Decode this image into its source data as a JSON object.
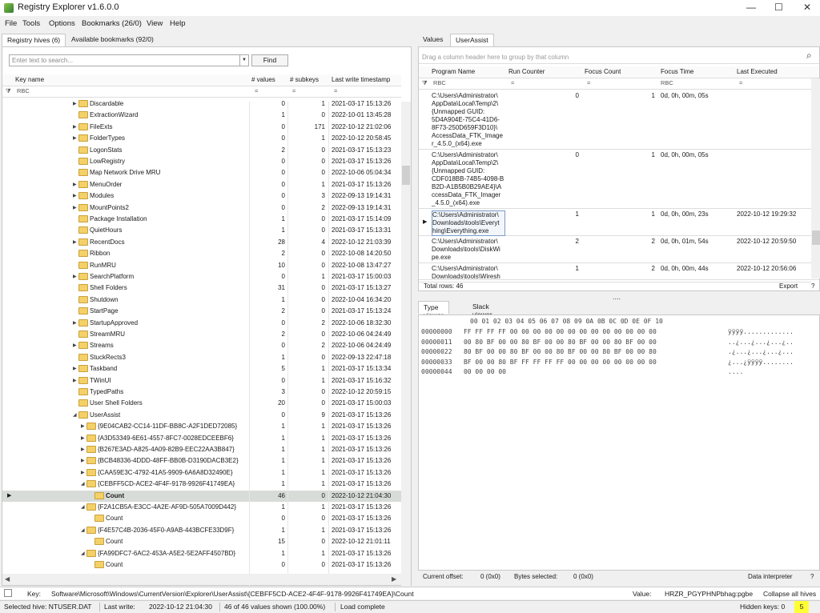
{
  "window": {
    "title": "Registry Explorer v1.6.0.0",
    "minimize": "—",
    "maximize": "☐",
    "close": "✕"
  },
  "menu": [
    "File",
    "Tools",
    "Options",
    "Bookmarks (26/0)",
    "View",
    "Help"
  ],
  "left_tabs": [
    "Registry hives (6)",
    "Available bookmarks (92/0)"
  ],
  "search": {
    "placeholder": "Enter text to search...",
    "find": "Find"
  },
  "tree_columns": [
    "Key name",
    "# values",
    "# subkeys",
    "Last write timestamp"
  ],
  "filter_glyph": "RBC",
  "filter_eq": "=",
  "tree_rows": [
    {
      "name": "Discardable",
      "values": "0",
      "subkeys": "1",
      "ts": "2021-03-17 15:13:26",
      "depth": 0,
      "exp": "▶"
    },
    {
      "name": "ExtractionWizard",
      "values": "1",
      "subkeys": "0",
      "ts": "2022-10-01 13:45:28",
      "depth": 0,
      "exp": ""
    },
    {
      "name": "FileExts",
      "values": "0",
      "subkeys": "171",
      "ts": "2022-10-12 21:02:06",
      "depth": 0,
      "exp": "▶"
    },
    {
      "name": "FolderTypes",
      "values": "0",
      "subkeys": "1",
      "ts": "2022-10-12 20:58:45",
      "depth": 0,
      "exp": "▶"
    },
    {
      "name": "LogonStats",
      "values": "2",
      "subkeys": "0",
      "ts": "2021-03-17 15:13:23",
      "depth": 0,
      "exp": ""
    },
    {
      "name": "LowRegistry",
      "values": "0",
      "subkeys": "0",
      "ts": "2021-03-17 15:13:26",
      "depth": 0,
      "exp": ""
    },
    {
      "name": "Map Network Drive MRU",
      "values": "0",
      "subkeys": "0",
      "ts": "2022-10-06 05:04:34",
      "depth": 0,
      "exp": ""
    },
    {
      "name": "MenuOrder",
      "values": "0",
      "subkeys": "1",
      "ts": "2021-03-17 15:13:26",
      "depth": 0,
      "exp": "▶"
    },
    {
      "name": "Modules",
      "values": "0",
      "subkeys": "3",
      "ts": "2022-09-13 19:14:31",
      "depth": 0,
      "exp": "▶"
    },
    {
      "name": "MountPoints2",
      "values": "0",
      "subkeys": "2",
      "ts": "2022-09-13 19:14:31",
      "depth": 0,
      "exp": "▶"
    },
    {
      "name": "Package Installation",
      "values": "1",
      "subkeys": "0",
      "ts": "2021-03-17 15:14:09",
      "depth": 0,
      "exp": ""
    },
    {
      "name": "QuietHours",
      "values": "1",
      "subkeys": "0",
      "ts": "2021-03-17 15:13:31",
      "depth": 0,
      "exp": ""
    },
    {
      "name": "RecentDocs",
      "values": "28",
      "subkeys": "4",
      "ts": "2022-10-12 21:03:39",
      "depth": 0,
      "exp": "▶"
    },
    {
      "name": "Ribbon",
      "values": "2",
      "subkeys": "0",
      "ts": "2022-10-08 14:20:50",
      "depth": 0,
      "exp": ""
    },
    {
      "name": "RunMRU",
      "values": "10",
      "subkeys": "0",
      "ts": "2022-10-08 13:47:27",
      "depth": 0,
      "exp": ""
    },
    {
      "name": "SearchPlatform",
      "values": "0",
      "subkeys": "1",
      "ts": "2021-03-17 15:00:03",
      "depth": 0,
      "exp": "▶"
    },
    {
      "name": "Shell Folders",
      "values": "31",
      "subkeys": "0",
      "ts": "2021-03-17 15:13:27",
      "depth": 0,
      "exp": ""
    },
    {
      "name": "Shutdown",
      "values": "1",
      "subkeys": "0",
      "ts": "2022-10-04 16:34:20",
      "depth": 0,
      "exp": ""
    },
    {
      "name": "StartPage",
      "values": "2",
      "subkeys": "0",
      "ts": "2021-03-17 15:13:24",
      "depth": 0,
      "exp": ""
    },
    {
      "name": "StartupApproved",
      "values": "0",
      "subkeys": "2",
      "ts": "2022-10-06 18:32:30",
      "depth": 0,
      "exp": "▶"
    },
    {
      "name": "StreamMRU",
      "values": "2",
      "subkeys": "0",
      "ts": "2022-10-06 04:24:49",
      "depth": 0,
      "exp": ""
    },
    {
      "name": "Streams",
      "values": "0",
      "subkeys": "2",
      "ts": "2022-10-06 04:24:49",
      "depth": 0,
      "exp": "▶"
    },
    {
      "name": "StuckRects3",
      "values": "1",
      "subkeys": "0",
      "ts": "2022-09-13 22:47:18",
      "depth": 0,
      "exp": ""
    },
    {
      "name": "Taskband",
      "values": "5",
      "subkeys": "1",
      "ts": "2021-03-17 15:13:34",
      "depth": 0,
      "exp": "▶"
    },
    {
      "name": "TWinUI",
      "values": "0",
      "subkeys": "1",
      "ts": "2021-03-17 15:16:32",
      "depth": 0,
      "exp": "▶"
    },
    {
      "name": "TypedPaths",
      "values": "3",
      "subkeys": "0",
      "ts": "2022-10-12 20:59:15",
      "depth": 0,
      "exp": ""
    },
    {
      "name": "User Shell Folders",
      "values": "20",
      "subkeys": "0",
      "ts": "2021-03-17 15:00:03",
      "depth": 0,
      "exp": ""
    },
    {
      "name": "UserAssist",
      "values": "0",
      "subkeys": "9",
      "ts": "2021-03-17 15:13:26",
      "depth": 0,
      "exp": "◢"
    },
    {
      "name": "{9E04CAB2-CC14-11DF-BB8C-A2F1DED72085}",
      "values": "1",
      "subkeys": "1",
      "ts": "2021-03-17 15:13:26",
      "depth": 1,
      "exp": "▶"
    },
    {
      "name": "{A3D53349-6E61-4557-8FC7-0028EDCEEBF6}",
      "values": "1",
      "subkeys": "1",
      "ts": "2021-03-17 15:13:26",
      "depth": 1,
      "exp": "▶"
    },
    {
      "name": "{B267E3AD-A825-4A09-82B9-EEC22AA3B847}",
      "values": "1",
      "subkeys": "1",
      "ts": "2021-03-17 15:13:26",
      "depth": 1,
      "exp": "▶"
    },
    {
      "name": "{BCB48336-4DDD-48FF-BB0B-D3190DACB3E2}",
      "values": "1",
      "subkeys": "1",
      "ts": "2021-03-17 15:13:26",
      "depth": 1,
      "exp": "▶"
    },
    {
      "name": "{CAA59E3C-4792-41A5-9909-6A6A8D32490E}",
      "values": "1",
      "subkeys": "1",
      "ts": "2021-03-17 15:13:26",
      "depth": 1,
      "exp": "▶"
    },
    {
      "name": "{CEBFF5CD-ACE2-4F4F-9178-9926F41749EA}",
      "values": "1",
      "subkeys": "1",
      "ts": "2021-03-17 15:13:26",
      "depth": 1,
      "exp": "◢"
    },
    {
      "name": "Count",
      "values": "46",
      "subkeys": "0",
      "ts": "2022-10-12 21:04:30",
      "depth": 2,
      "exp": "",
      "selected": true
    },
    {
      "name": "{F2A1CB5A-E3CC-4A2E-AF9D-505A7009D442}",
      "values": "1",
      "subkeys": "1",
      "ts": "2021-03-17 15:13:26",
      "depth": 1,
      "exp": "◢"
    },
    {
      "name": "Count",
      "values": "0",
      "subkeys": "0",
      "ts": "2021-03-17 15:13:26",
      "depth": 2,
      "exp": ""
    },
    {
      "name": "{F4E57C4B-2036-45F0-A9AB-443BCFE33D9F}",
      "values": "1",
      "subkeys": "1",
      "ts": "2021-03-17 15:13:26",
      "depth": 1,
      "exp": "◢"
    },
    {
      "name": "Count",
      "values": "15",
      "subkeys": "0",
      "ts": "2022-10-12 21:01:11",
      "depth": 2,
      "exp": ""
    },
    {
      "name": "{FA99DFC7-6AC2-453A-A5E2-5E2AFF4507BD}",
      "values": "1",
      "subkeys": "1",
      "ts": "2021-03-17 15:13:26",
      "depth": 1,
      "exp": "◢"
    },
    {
      "name": "Count",
      "values": "0",
      "subkeys": "0",
      "ts": "2021-03-17 15:13:26",
      "depth": 2,
      "exp": ""
    }
  ],
  "right_tabs": [
    "Values",
    "UserAssist"
  ],
  "group_hint": "Drag a column header here to group by that column",
  "ua_columns": [
    "Program Name",
    "Run Counter",
    "Focus Count",
    "Focus Time",
    "Last Executed"
  ],
  "ua_rows": [
    {
      "program": "C:\\Users\\Administrator\\\nAppData\\Local\\Temp\\2\\\n{Unmapped GUID:\n5D4A904E-75C4-41D6-\n8F73-250D659F3D10}\\\nAccessData_FTK_Image\nr_4.5.0_(x64).exe",
      "run": "0",
      "focus": "1",
      "time": "0d, 0h, 00m, 05s",
      "last": ""
    },
    {
      "program": "C:\\Users\\Administrator\\\nAppData\\Local\\Temp\\2\\\n{Unmapped GUID:\nCDF018BB-74B5-4098-B\nB2D-A1B5B0B29AE4}\\A\nccessData_FTK_Imager\n_4.5.0_(x64).exe",
      "run": "0",
      "focus": "1",
      "time": "0d, 0h, 00m, 05s",
      "last": ""
    },
    {
      "program": "C:\\Users\\Administrator\\\nDownloads\\tools\\Everyt\nhing\\Everything.exe",
      "run": "1",
      "focus": "1",
      "time": "0d, 0h, 00m, 23s",
      "last": "2022-10-12 19:29:32"
    },
    {
      "program": "C:\\Users\\Administrator\\\nDownloads\\tools\\DiskWi\npe.exe",
      "run": "2",
      "focus": "2",
      "time": "0d, 0h, 01m, 54s",
      "last": "2022-10-12 20:59:50"
    },
    {
      "program": "C:\\Users\\Administrator\\\nDownloads\\tools\\Wiresh",
      "run": "1",
      "focus": "2",
      "time": "0d, 0h, 00m, 44s",
      "last": "2022-10-12 20:56:06"
    }
  ],
  "total_rows": "Total rows: 46",
  "export": "Export",
  "help": "?",
  "splitter": "....",
  "viewer_tabs": [
    "Type viewer",
    "Slack viewer"
  ],
  "hex_header": "00 01 02 03 04 05 06 07 08 09 0A 0B 0C 0D 0E 0F 10",
  "hex_rows": [
    {
      "off": "00000000",
      "bytes": "FF FF FF FF 00 00 00 00 00 00 00 00 00 00 00 00 00",
      "ascii": "ÿÿÿÿ............."
    },
    {
      "off": "00000011",
      "bytes": "00 80 BF 00 00 80 BF 00 00 80 BF 00 00 80 BF 00 00",
      "ascii": "..¿...¿...¿...¿.."
    },
    {
      "off": "00000022",
      "bytes": "80 BF 00 00 80 BF 00 00 80 BF 00 00 80 BF 00 00 80",
      "ascii": ".¿...¿...¿...¿..."
    },
    {
      "off": "00000033",
      "bytes": "BF 00 00 80 BF FF FF FF FF 00 00 00 00 00 00 00 00",
      "ascii": "¿...¿ÿÿÿÿ........"
    },
    {
      "off": "00000044",
      "bytes": "00 00 00 00",
      "ascii": "...."
    }
  ],
  "hex_status": {
    "offset_label": "Current offset:",
    "offset": "0 (0x0)",
    "bytes_label": "Bytes selected:",
    "bytes": "0 (0x0)",
    "interpreter": "Data interpreter",
    "help": "?"
  },
  "keybar": {
    "key_label": "Key:",
    "key": "Software\\Microsoft\\Windows\\CurrentVersion\\Explorer\\UserAssist\\{CEBFF5CD-ACE2-4F4F-9178-9926F41749EA}\\Count",
    "value_label": "Value:",
    "value": "HRZR_PGYPHNPbhag:pgbe",
    "collapse": "Collapse all hives"
  },
  "status": {
    "hive": "Selected hive: NTUSER.DAT",
    "lw_label": "Last write:",
    "lw": "2022-10-12 21:04:30",
    "shown": "46 of 46 values shown (100.00%)",
    "load": "Load complete",
    "hidden_label": "Hidden keys: 0",
    "hidden_badge": "5"
  }
}
